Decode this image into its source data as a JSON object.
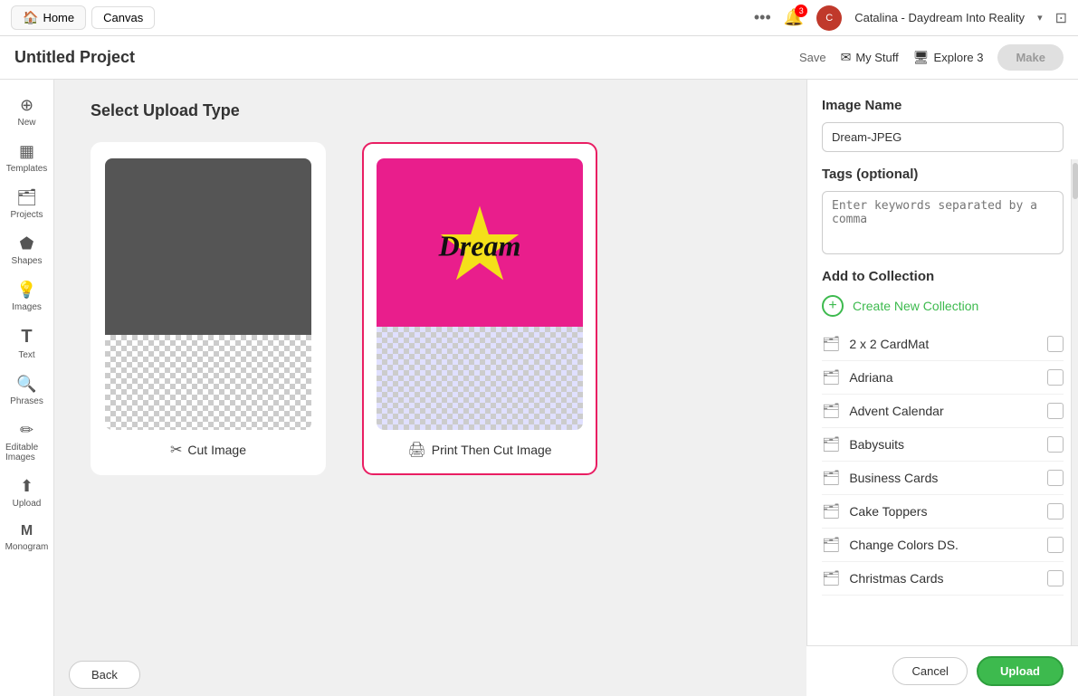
{
  "topbar": {
    "home_tab": "Home",
    "canvas_tab": "Canvas",
    "dots_label": "More options",
    "bell_badge": "3",
    "user_name": "Catalina - Daydream Into Reality",
    "window_icon": "⊡"
  },
  "header": {
    "project_title": "Untitled Project",
    "save_label": "Save",
    "my_stuff_label": "My Stuff",
    "explore_label": "Explore 3",
    "make_label": "Make"
  },
  "sidebar": {
    "items": [
      {
        "label": "New",
        "icon": "⊕"
      },
      {
        "label": "Templates",
        "icon": "▦"
      },
      {
        "label": "Projects",
        "icon": "🗂"
      },
      {
        "label": "Shapes",
        "icon": "⬟"
      },
      {
        "label": "Images",
        "icon": "💡"
      },
      {
        "label": "Text",
        "icon": "T"
      },
      {
        "label": "Phrases",
        "icon": "🔍"
      },
      {
        "label": "Editable Images",
        "icon": "✏"
      },
      {
        "label": "Upload",
        "icon": "⬆"
      },
      {
        "label": "Monogram",
        "icon": "M"
      }
    ]
  },
  "main": {
    "section_title": "Select Upload Type",
    "cut_image_label": "Cut Image",
    "print_then_cut_label": "Print Then Cut Image",
    "dream_text": "Dream",
    "back_label": "Back"
  },
  "right_panel": {
    "image_name_label": "Image Name",
    "image_name_value": "Dream-JPEG",
    "image_name_placeholder": "Dream-JPEG",
    "tags_label": "Tags (optional)",
    "tags_placeholder": "Enter keywords separated by a comma",
    "add_collection_label": "Add to Collection",
    "create_new_label": "Create New Collection",
    "collections": [
      {
        "name": "2 x 2 CardMat",
        "checked": false
      },
      {
        "name": "Adriana",
        "checked": false
      },
      {
        "name": "Advent Calendar",
        "checked": false
      },
      {
        "name": "Babysuits",
        "checked": false
      },
      {
        "name": "Business Cards",
        "checked": false
      },
      {
        "name": "Cake Toppers",
        "checked": false
      },
      {
        "name": "Change Colors DS.",
        "checked": false
      },
      {
        "name": "Christmas Cards",
        "checked": false
      }
    ],
    "cancel_label": "Cancel",
    "upload_label": "Upload"
  }
}
